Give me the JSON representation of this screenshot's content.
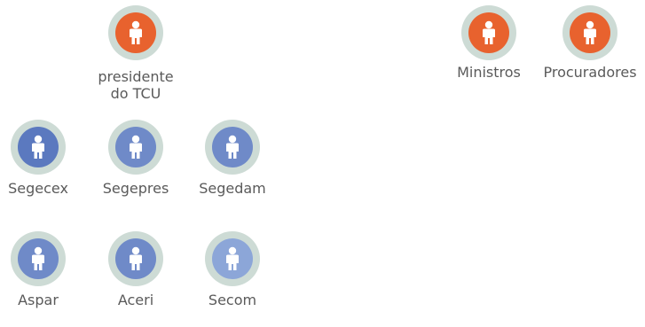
{
  "colors": {
    "ring": "#cddbd5",
    "orange": "#e8622e",
    "blue_dark": "#5b79bf",
    "blue_mid": "#6f8ac8",
    "blue_light": "#8ca6d8",
    "text": "#5a5a5a"
  },
  "nodes": [
    {
      "id": "presidente",
      "label": "presidente\ndo TCU",
      "color": "orange",
      "icon": "person-icon"
    },
    {
      "id": "ministros",
      "label": "Ministros",
      "color": "orange",
      "icon": "person-icon"
    },
    {
      "id": "procuradores",
      "label": "Procuradores",
      "color": "orange",
      "icon": "person-icon"
    },
    {
      "id": "segecex",
      "label": "Segecex",
      "color": "blue_dark",
      "icon": "person-icon"
    },
    {
      "id": "segepres",
      "label": "Segepres",
      "color": "blue_mid",
      "icon": "person-icon"
    },
    {
      "id": "segedam",
      "label": "Segedam",
      "color": "blue_mid",
      "icon": "person-icon"
    },
    {
      "id": "aspar",
      "label": "Aspar",
      "color": "blue_mid",
      "icon": "person-icon"
    },
    {
      "id": "aceri",
      "label": "Aceri",
      "color": "blue_mid",
      "icon": "person-icon"
    },
    {
      "id": "secom",
      "label": "Secom",
      "color": "blue_light",
      "icon": "person-icon"
    }
  ]
}
